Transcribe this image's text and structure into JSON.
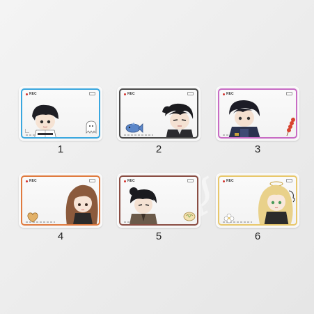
{
  "cards": [
    {
      "number": "1",
      "rec": "REC",
      "frame_color": "#3aa7df"
    },
    {
      "number": "2",
      "rec": "REC",
      "frame_color": "#4a4a4a"
    },
    {
      "number": "3",
      "rec": "REC",
      "frame_color": "#c86bc4"
    },
    {
      "number": "4",
      "rec": "REC",
      "frame_color": "#e07a3e"
    },
    {
      "number": "5",
      "rec": "REC",
      "frame_color": "#8a4d43"
    },
    {
      "number": "6",
      "rec": "REC",
      "frame_color": "#e8c76a"
    }
  ],
  "icons": [
    "ghost-icon",
    "fish-icon",
    "candied-fruit-skewer-icon",
    "cookie-icon",
    "bun-icon",
    "flower-icon"
  ]
}
